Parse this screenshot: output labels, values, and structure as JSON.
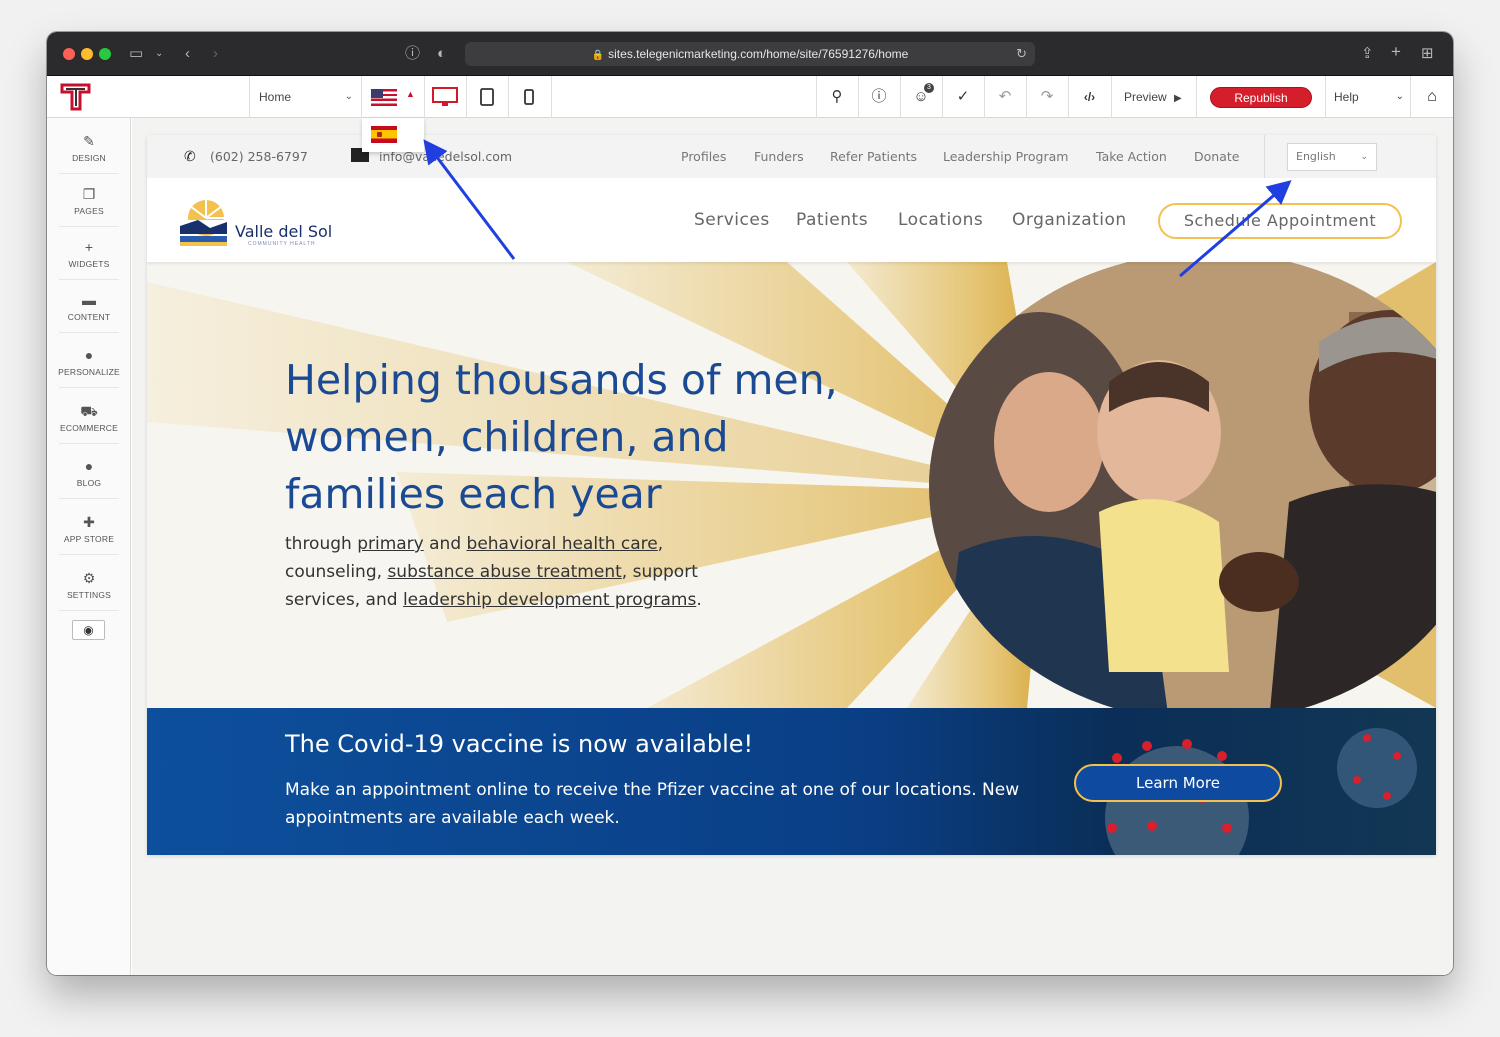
{
  "browser": {
    "url": "sites.telegenicmarketing.com/home/site/76591276/home"
  },
  "toolbar": {
    "page_select": "Home",
    "preview_label": "Preview",
    "republish_label": "Republish",
    "help_label": "Help",
    "notification_count": "3"
  },
  "sidebar": {
    "items": [
      {
        "label": "DESIGN",
        "icon": "brush-icon"
      },
      {
        "label": "PAGES",
        "icon": "pages-icon"
      },
      {
        "label": "WIDGETS",
        "icon": "plus-icon"
      },
      {
        "label": "CONTENT",
        "icon": "folder-icon"
      },
      {
        "label": "PERSONALIZE",
        "icon": "person-icon"
      },
      {
        "label": "ECOMMERCE",
        "icon": "cart-icon"
      },
      {
        "label": "BLOG",
        "icon": "chat-bubble-icon"
      },
      {
        "label": "APP STORE",
        "icon": "puzzle-icon"
      },
      {
        "label": "SETTINGS",
        "icon": "gear-icon"
      }
    ]
  },
  "site": {
    "phone": "(602) 258-6797",
    "email": "info@valledelsol.com",
    "utility_links": [
      "Profiles",
      "Funders",
      "Refer Patients",
      "Leadership Program",
      "Take Action",
      "Donate"
    ],
    "language_select": "English",
    "brand_name": "Valle del Sol",
    "brand_sub": "COMMUNITY HEALTH",
    "nav": [
      "Services",
      "Patients",
      "Locations",
      "Organization"
    ],
    "schedule_label": "Schedule Appointment",
    "hero": {
      "title": "Helping thousands of men, women, children, and families each year",
      "sub_1": "through ",
      "link_primary": "primary",
      "sub_2": " and ",
      "link_behavioral": "behavioral health care",
      "sub_3": ", counseling, ",
      "link_substance": "substance abuse treatment",
      "sub_4": ", support services, and ",
      "link_leadership": "leadership development programs",
      "sub_5": "."
    },
    "covid": {
      "title": "The Covid-19 vaccine is now available!",
      "text": "Make an appointment online to receive the Pfizer vaccine at one of our locations. New appointments are available each week.",
      "button": "Learn More"
    }
  },
  "colors": {
    "brand_red": "#d51e2b",
    "site_blue": "#1b4a94",
    "gold": "#f2c14e",
    "annotation_arrow": "#1f3fe0"
  }
}
